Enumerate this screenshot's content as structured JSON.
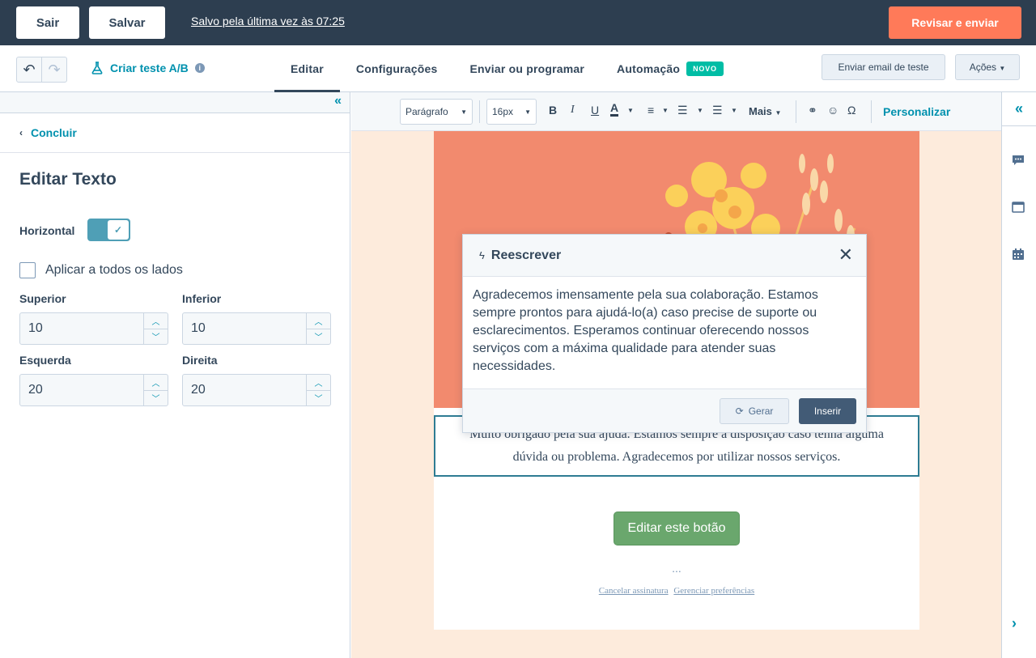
{
  "topbar": {
    "exit_label": "Sair",
    "save_label": "Salvar",
    "saved_status": "Salvo pela última vez às 07:25",
    "review_label": "Revisar e enviar"
  },
  "navbar": {
    "ab_test_label": "Criar teste A/B",
    "tabs": [
      {
        "label": "Editar"
      },
      {
        "label": "Configurações"
      },
      {
        "label": "Enviar ou programar"
      },
      {
        "label": "Automação",
        "badge": "NOVO"
      }
    ],
    "test_email_label": "Enviar email de teste",
    "actions_label": "Ações"
  },
  "left_panel": {
    "back_label": "Concluir",
    "title": "Editar Texto",
    "horizontal_label": "Horizontal",
    "horizontal_on": true,
    "apply_all_label": "Aplicar a todos os lados",
    "apply_all_checked": false,
    "fields": {
      "top": {
        "label": "Superior",
        "value": "10"
      },
      "bottom": {
        "label": "Inferior",
        "value": "10"
      },
      "left": {
        "label": "Esquerda",
        "value": "20"
      },
      "right": {
        "label": "Direita",
        "value": "20"
      }
    }
  },
  "toolbar": {
    "block_type": "Parágrafo",
    "font_size": "16px",
    "more_label": "Mais",
    "personalize_label": "Personalizar"
  },
  "email": {
    "text_block": "Muito obrigado pela sua ajuda. Estamos sempre à disposição caso tenha alguma dúvida ou problema. Agradecemos por utilizar nossos serviços.",
    "button_label": "Editar este botão",
    "ellipsis": "...",
    "unsubscribe_label": "Cancelar assinatura",
    "preferences_label": "Gerenciar preferências"
  },
  "modal": {
    "title": "Reescrever",
    "body": "Agradecemos imensamente pela sua colaboração. Estamos sempre prontos para ajudá-lo(a) caso precise de suporte ou esclarecimentos. Esperamos continuar oferecendo nossos serviços com a máxima qualidade para atender suas necessidades.",
    "generate_label": "Gerar",
    "insert_label": "Inserir"
  },
  "colors": {
    "topbar_bg": "#2d3e50",
    "accent_orange": "#ff7a59",
    "teal_link": "#0091ae",
    "badge_green": "#00bda5",
    "email_button": "#6aa76d",
    "hero_bg": "#f28a6e",
    "canvas_bg": "#fdebdc"
  }
}
